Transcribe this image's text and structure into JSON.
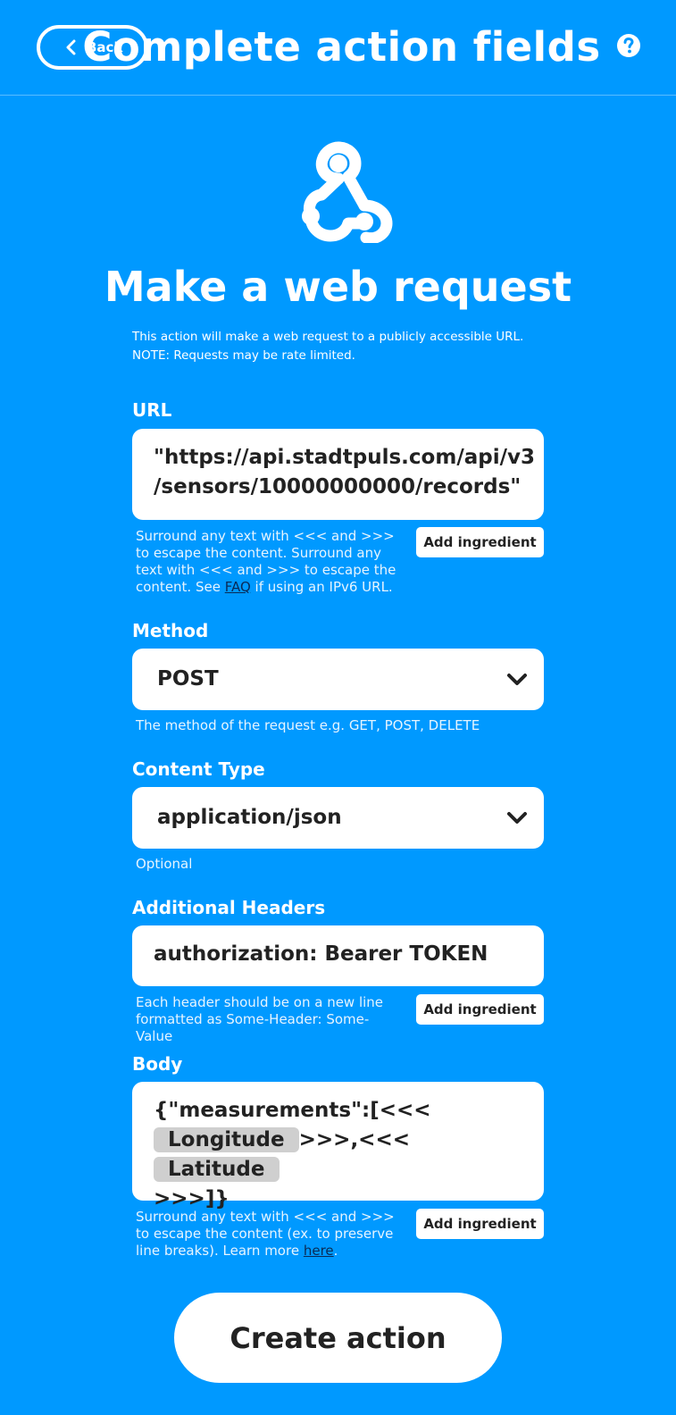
{
  "header": {
    "back_label": "Back",
    "title": "Complete action fields"
  },
  "action": {
    "title": "Make a web request",
    "description": "This action will make a web request to a publicly accessible URL. NOTE: Requests may be rate limited."
  },
  "fields": {
    "url": {
      "label": "URL",
      "value_line1": "\"https://api.stadtpuls.com/api/v3",
      "value_line2": "/sensors/10000000000/records\"",
      "helper_text": "Surround any text with <<< and >>> to escape the content. Surround any text with <<< and >>> to escape the content. See ",
      "helper_link": "FAQ",
      "helper_suffix": " if using an IPv6 URL.",
      "ingredient_label": "Add ingredient"
    },
    "method": {
      "label": "Method",
      "value": "POST",
      "helper_text": "The method of the request e.g. GET, POST, DELETE"
    },
    "content_type": {
      "label": "Content Type",
      "value": "application/json",
      "helper_text": "Optional"
    },
    "headers": {
      "label": "Additional Headers",
      "value": "authorization: Bearer TOKEN",
      "helper_text": "Each header should be on a new line formatted as Some-Header: Some-Value",
      "ingredient_label": "Add ingredient"
    },
    "body": {
      "label": "Body",
      "line1": "{\"measurements\":[<<<",
      "ingredient1": "Longitude",
      "mid_text": ">>>,<<<",
      "ingredient2": "Latitude",
      "line3": ">>>]}",
      "helper_text": "Surround any text with <<< and >>> to escape the content (ex. to preserve line breaks). Learn more ",
      "helper_link": "here",
      "helper_suffix": ".",
      "ingredient_label": "Add ingredient"
    }
  },
  "create_button_label": "Create action",
  "colors": {
    "background": "#0099ff",
    "card": "#ffffff",
    "text_dark": "#222222",
    "ingredient_pill": "#cfcfcf"
  },
  "icons": [
    "chevron-left-icon",
    "help-icon",
    "webhook-icon",
    "chevron-down-icon"
  ]
}
